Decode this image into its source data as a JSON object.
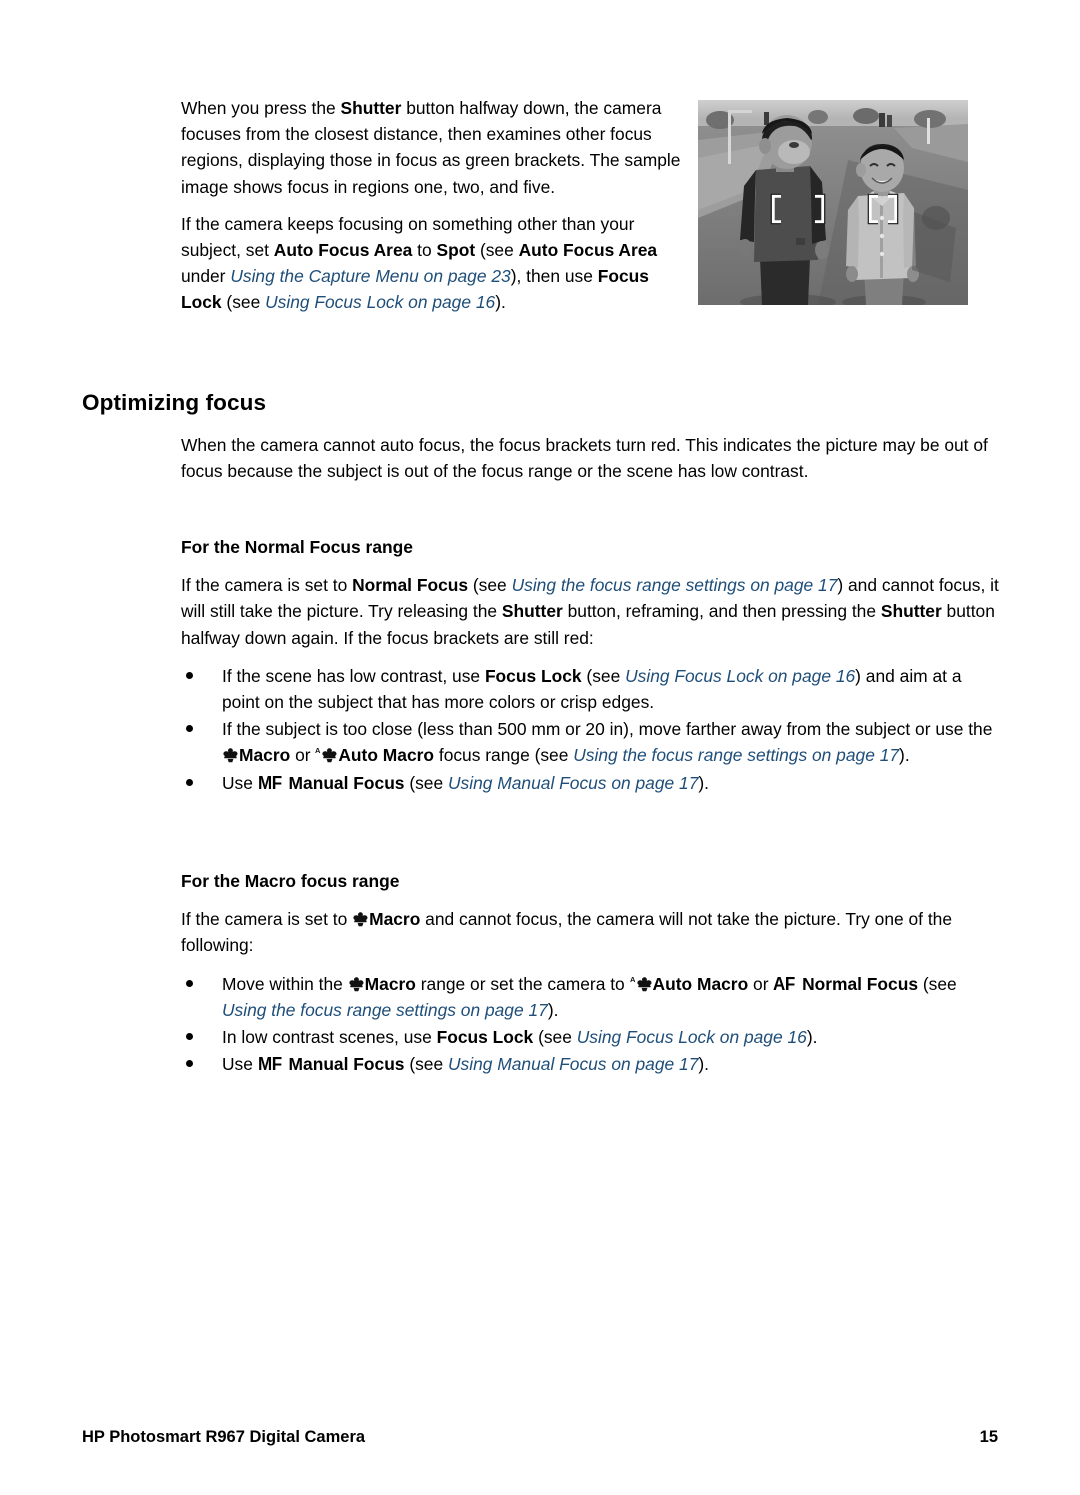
{
  "document": {
    "footer_left": "HP Photosmart R967 Digital Camera",
    "page_number": "15",
    "link_color": "#1f4e79",
    "text_color": "#000000",
    "background": "#ffffff"
  },
  "intro": {
    "p1": {
      "t1": "When you press the ",
      "b1": "Shutter",
      "t2": " button halfway down, the camera focuses from the closest distance, then examines other focus regions, displaying those in focus as green brackets. The sample image shows focus in regions one, two, and five."
    },
    "p2": {
      "t1": "If the camera keeps focusing on something other than your subject, set ",
      "b1": "Auto Focus Area",
      "t2": " to ",
      "b2": "Spot",
      "t3": " (see ",
      "b3": "Auto Focus Area",
      "t4": " under ",
      "l1": "Using the Capture Menu on page 23",
      "t5": "), then use ",
      "b4": "Focus Lock",
      "t6": " (see ",
      "l2": "Using Focus Lock on page 16",
      "t7": ")."
    }
  },
  "photo": {
    "caption": "sample-photo-two-boys-with-focus-brackets",
    "alt": "Black and white photograph of two boys standing on a road with focus brackets overlaid"
  },
  "section": {
    "heading": "Optimizing focus",
    "intro": "When the camera cannot auto focus, the focus brackets turn red. This indicates the picture may be out of focus because the subject is out of the focus range or the scene has low contrast."
  },
  "normal_focus": {
    "heading": "For the Normal Focus range",
    "paragraph": {
      "t1": "If the camera is set to ",
      "b1": "Normal Focus",
      "t2": " (see ",
      "l1": "Using the focus range settings on page 17",
      "t3": ") and cannot focus, it will still take the picture. Try releasing the ",
      "b2": "Shutter",
      "t4": " button, reframing, and then pressing the ",
      "b3": "Shutter",
      "t5": " button halfway down again. If the focus brackets are still red:"
    },
    "bullets": [
      {
        "t1": "If the scene has low contrast, use ",
        "b1": "Focus Lock",
        "t2": " (see ",
        "l1": "Using Focus Lock on page 16",
        "t3": ") and aim at a point on the subject that has more colors or crisp edges."
      },
      {
        "t1": "If the subject is too close (less than 500 mm or 20 in), move farther away from the subject or use the ",
        "icon1": "macro-icon",
        "b1": "Macro",
        "t2": " or ",
        "icon2": "auto-macro-icon",
        "b2": "Auto Macro",
        "t3": " focus range (see ",
        "l1": "Using the focus range settings on page 17",
        "t4": ")."
      },
      {
        "t1": "Use ",
        "icon1": "manual-focus-icon",
        "icon1_label": "MF",
        "b1": "Manual Focus",
        "t2": " (see ",
        "l1": "Using Manual Focus on page 17",
        "t3": ")."
      }
    ]
  },
  "macro_focus": {
    "heading": "For the Macro focus range",
    "paragraph": {
      "t1": "If the camera is set to ",
      "icon1": "macro-icon",
      "b1": "Macro",
      "t2": " and cannot focus, the camera will not take the picture. Try one of the following:"
    },
    "bullets": [
      {
        "t1": "Move within the ",
        "icon1": "macro-icon",
        "b1": "Macro",
        "t2": " range or set the camera to ",
        "icon2": "auto-macro-icon",
        "b2": "Auto Macro",
        "t3": " or ",
        "icon3": "auto-focus-icon",
        "icon3_label": "AF",
        "b3": "Normal Focus",
        "t4": " (see ",
        "l1": "Using the focus range settings on page 17",
        "t5": ")."
      },
      {
        "t1": "In low contrast scenes, use ",
        "b1": "Focus Lock",
        "t2": " (see ",
        "l1": "Using Focus Lock on page 16",
        "t3": ")."
      },
      {
        "t1": "Use ",
        "icon1": "manual-focus-icon",
        "icon1_label": "MF",
        "b1": "Manual Focus",
        "t2": " (see ",
        "l1": "Using Manual Focus on page 17",
        "t3": ")."
      }
    ]
  }
}
